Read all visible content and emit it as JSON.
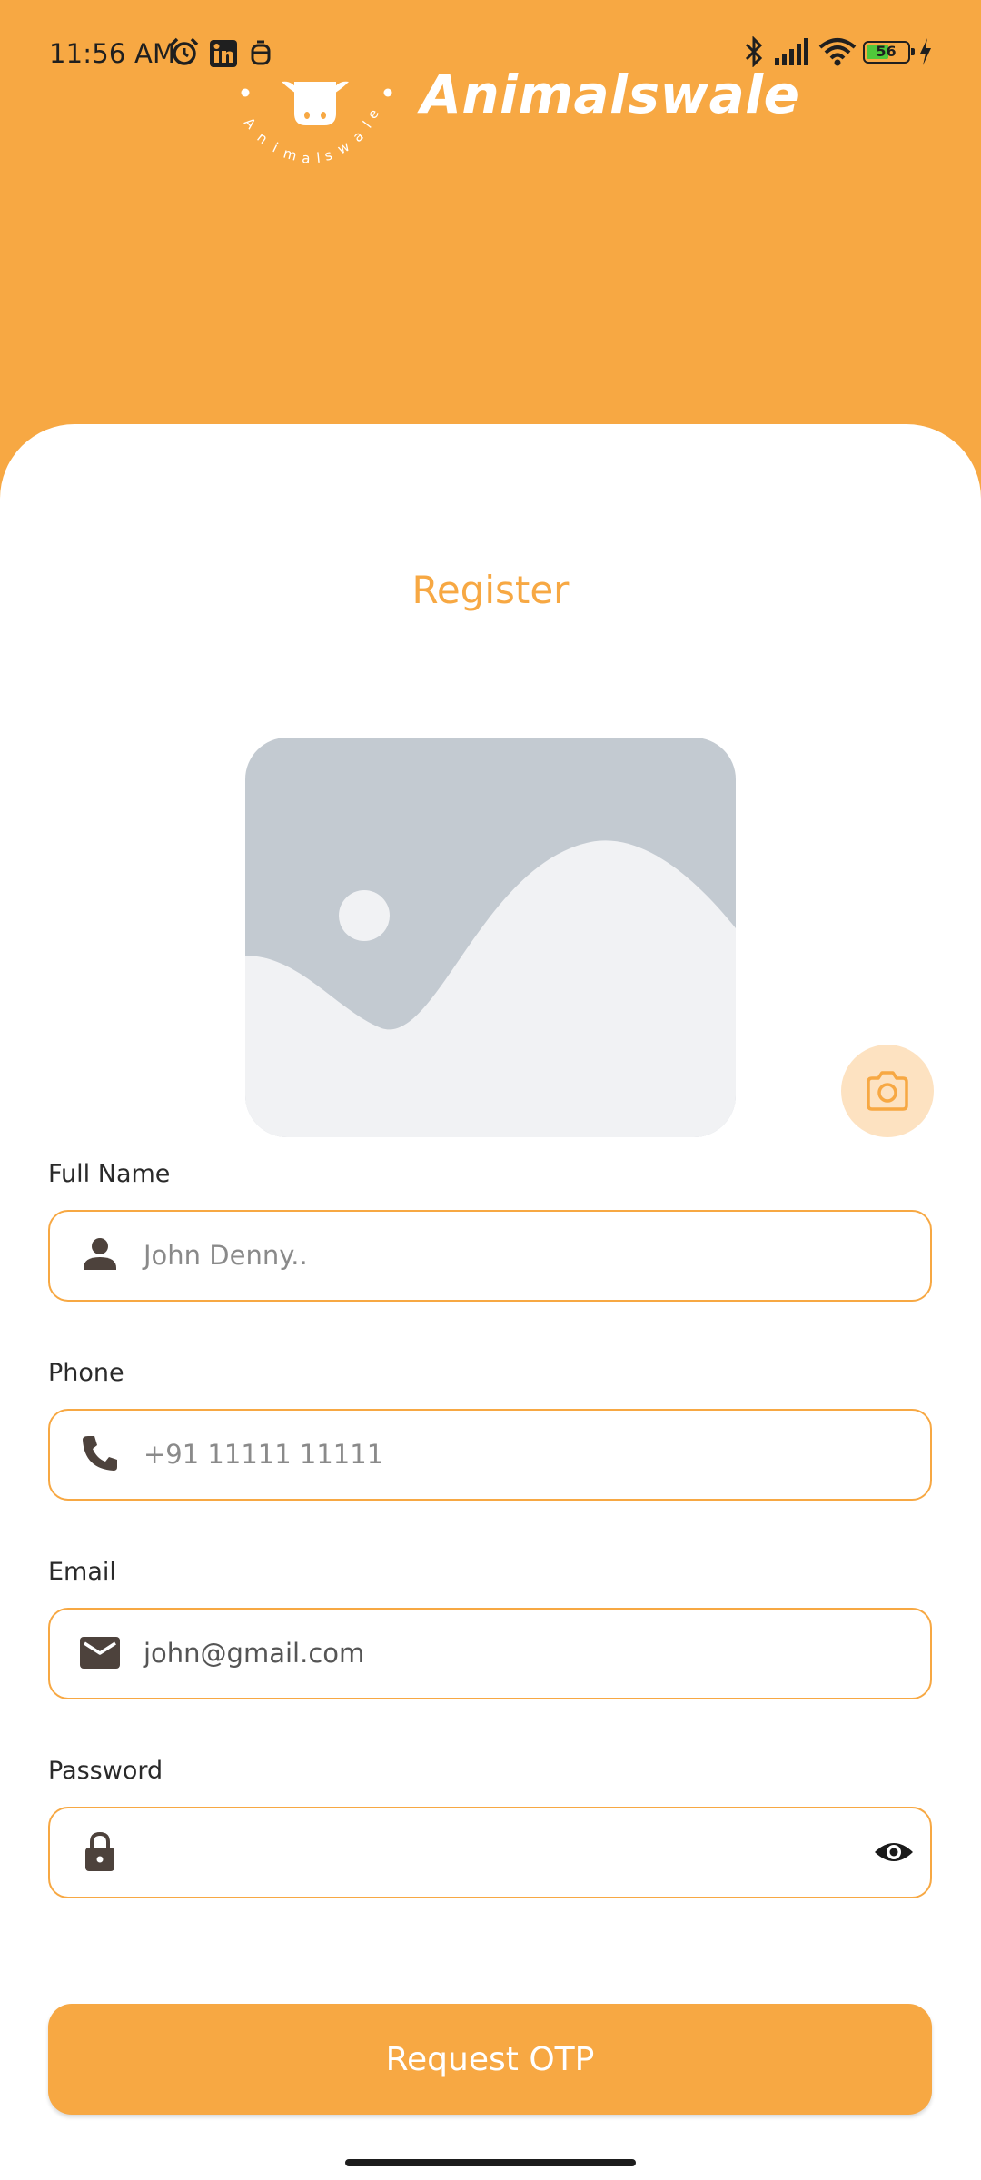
{
  "status_bar": {
    "time": "11:56 AM",
    "battery_level": "56",
    "icons": [
      "alarm-icon",
      "linkedin-icon",
      "notification-icon",
      "bluetooth-icon",
      "signal-icon",
      "wifi-icon",
      "battery-icon",
      "charging-icon"
    ]
  },
  "header": {
    "brand_name": "Animalswale",
    "logo_text": "Animalswale"
  },
  "page": {
    "title": "Register"
  },
  "photo": {
    "placeholder_icon": "image-placeholder-icon",
    "camera_icon": "camera-icon"
  },
  "form": {
    "full_name": {
      "label": "Full Name",
      "placeholder": "John Denny..",
      "icon": "person-icon"
    },
    "phone": {
      "label": "Phone",
      "placeholder": "+91 11111 11111",
      "icon": "phone-icon"
    },
    "email": {
      "label": "Email",
      "value": "john@gmail.com",
      "icon": "mail-icon"
    },
    "password": {
      "label": "Password",
      "value": "",
      "icon": "lock-icon",
      "toggle_icon": "eye-icon"
    }
  },
  "actions": {
    "request_otp_label": "Request OTP"
  },
  "colors": {
    "accent": "#f7a843",
    "accent_light": "#fde2c1",
    "icon_dark": "#4d423c",
    "placeholder_image_bg": "#c3cad1",
    "placeholder_image_fg": "#f1f2f4"
  }
}
